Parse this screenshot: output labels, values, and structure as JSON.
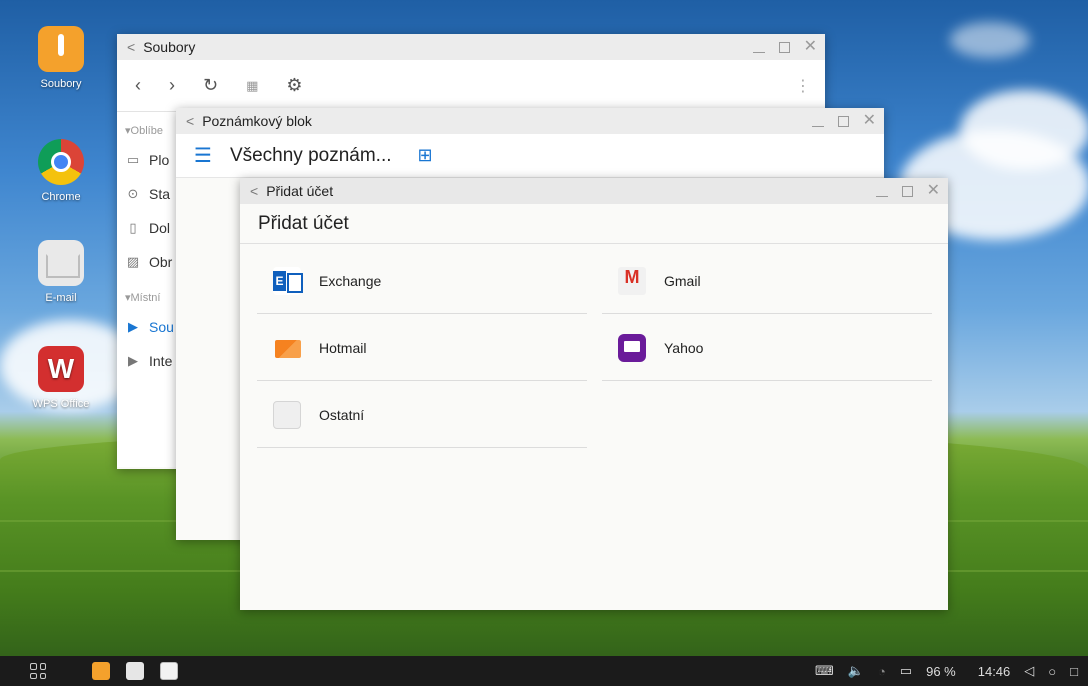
{
  "desktop": {
    "icons": [
      {
        "label": "Soubory",
        "icon": "files-icon"
      },
      {
        "label": "Chrome",
        "icon": "chrome-icon"
      },
      {
        "label": "E-mail",
        "icon": "email-icon"
      },
      {
        "label": "WPS Office",
        "icon": "wps-office-icon"
      }
    ]
  },
  "files_window": {
    "title": "Soubory",
    "sidebar": {
      "section_favorites": "▾Oblíbe",
      "items_favorites": [
        "Plo",
        "Sta",
        "Dol",
        "Obr"
      ],
      "section_local": "▾Místní",
      "items_local": [
        "Sou",
        "Inte"
      ]
    }
  },
  "notes_window": {
    "title": "Poznámkový blok",
    "header": "Všechny poznám..."
  },
  "account_window": {
    "title": "Přidat účet",
    "header": "Přidat účet",
    "accounts": [
      {
        "label": "Exchange"
      },
      {
        "label": "Gmail"
      },
      {
        "label": "Hotmail"
      },
      {
        "label": "Yahoo"
      },
      {
        "label": "Ostatní"
      }
    ]
  },
  "taskbar": {
    "battery": "96 %",
    "time": "14:46"
  },
  "colors": {
    "accent": "#1976d2",
    "taskbar": "#1b1b1b",
    "titlebar": "#ececec"
  }
}
